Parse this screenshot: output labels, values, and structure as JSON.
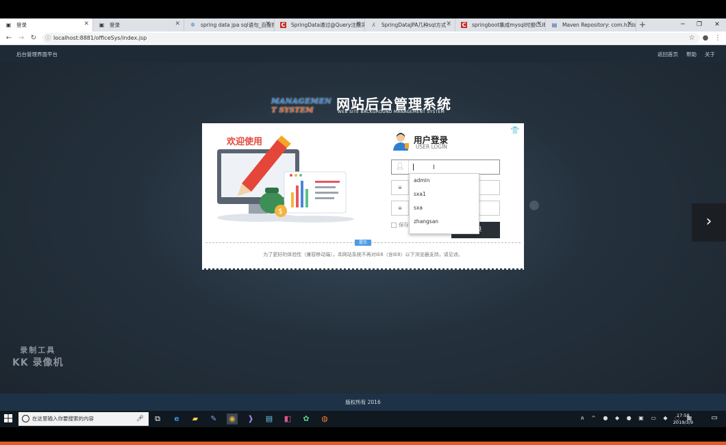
{
  "browser": {
    "tabs": [
      {
        "title": "登录",
        "active": true,
        "icon": "page-icon"
      },
      {
        "title": "登录",
        "active": false,
        "icon": "page-icon"
      },
      {
        "title": "spring data jpa sql语句_百度搜",
        "active": false,
        "icon": "baidu-icon"
      },
      {
        "title": "SpringData通过@Query注解实",
        "active": false,
        "icon": "csdn-icon"
      },
      {
        "title": "SpringDataJPA几种sql方式 - ",
        "active": false,
        "icon": "jianshu-icon"
      },
      {
        "title": "springboot集成mysql时报CLIE",
        "active": false,
        "icon": "csdn-icon"
      },
      {
        "title": "Maven Repository: com.h2dat",
        "active": false,
        "icon": "maven-icon"
      }
    ],
    "url": "localhost:8881/officeSys/index.jsp"
  },
  "topnav": {
    "brand": "后台管理界面平台",
    "links": [
      "返回首页",
      "帮助",
      "关于"
    ]
  },
  "logo": {
    "mark_line1": "MANAGEMEN",
    "mark_line2": "T SYSTEM",
    "title": "网站后台管理系统",
    "subtitle": "WEB SITE BACKGROUND MANAGEMENT SYSTEM"
  },
  "login": {
    "welcome": "欢迎使用",
    "title": "用户登录",
    "subtitle": "USER LOGIN",
    "username_value": "",
    "remember_label": "保存",
    "login_button": "登录",
    "autocomplete_options": [
      "admin",
      "sxa1",
      "sxa",
      "zhangsan"
    ],
    "tip_badge": "提示",
    "notice": "为了更好的体验性（兼容移动端），本网站系统不再对IE8（含IE8）以下浏览器支持，请见谅。"
  },
  "watermark": {
    "line1": "录制工具",
    "line2": "KK 录像机"
  },
  "footer": {
    "copyright": "版权所有 2016"
  },
  "taskbar": {
    "search_placeholder": "在这里输入你要搜索的内容",
    "time": "17:58",
    "date": "2019/3/9"
  },
  "colors": {
    "accent_red": "#e4473a",
    "login_button_bg": "#2a2f36",
    "footer_bg": "#1e3247",
    "tip_blue": "#4c9be6"
  }
}
